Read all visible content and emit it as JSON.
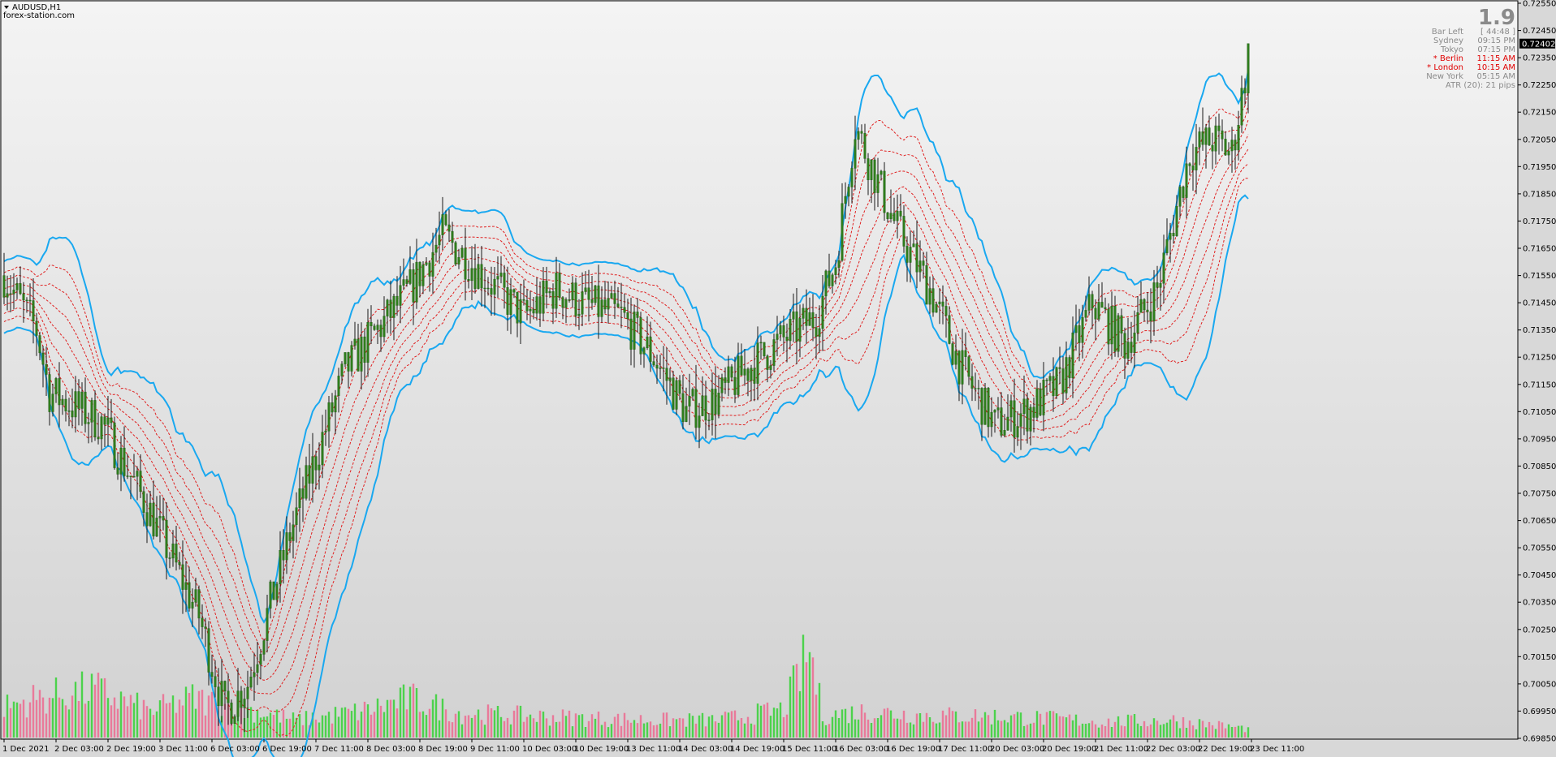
{
  "window": {
    "symbol_title": "AUDUSD,H1",
    "watermark": "forex-station.com"
  },
  "info_panel": {
    "spread": "1.9",
    "rows": [
      {
        "label": "Bar Left",
        "value": "[ 44:48 ]",
        "highlight": false
      },
      {
        "label": "Sydney",
        "value": "09:15 PM",
        "highlight": false
      },
      {
        "label": "Tokyo",
        "value": "07:15 PM",
        "highlight": false
      },
      {
        "label": "* Berlin",
        "value": "11:15 AM",
        "highlight": true
      },
      {
        "label": "* London",
        "value": "10:15 AM",
        "highlight": true
      },
      {
        "label": "New York",
        "value": "05:15 AM",
        "highlight": false
      },
      {
        "label": "ATR (20): 21 pips",
        "value": "",
        "highlight": false
      }
    ]
  },
  "colors": {
    "background_top": "#f4f4f4",
    "background_bottom": "#d2d2d2",
    "candle_bull": "#2e7d1c",
    "candle_bear": "#2e7d1c",
    "wick": "#1a1a1a",
    "band_outer": "#19a8f0",
    "band_inner": "#e02020",
    "volume_up": "#4cd24c",
    "volume_down": "#e97a9a",
    "price_tag_bg": "#000000",
    "price_tag_fg": "#ffffff"
  },
  "chart_data": {
    "type": "candlestick",
    "symbol": "AUDUSD",
    "timeframe": "H1",
    "ylim": [
      0.6985,
      0.7255
    ],
    "current_price": 0.72402,
    "current_price_label": "0.72402",
    "y_ticks": [
      "0.72550",
      "0.72450",
      "0.72350",
      "0.72250",
      "0.72150",
      "0.72050",
      "0.71950",
      "0.71850",
      "0.71750",
      "0.71650",
      "0.71550",
      "0.71450",
      "0.71350",
      "0.71250",
      "0.71150",
      "0.71050",
      "0.70950",
      "0.70850",
      "0.70750",
      "0.70650",
      "0.70550",
      "0.70450",
      "0.70350",
      "0.70250",
      "0.70150",
      "0.70050",
      "0.69950",
      "0.69850"
    ],
    "x_ticks": [
      "1 Dec 2021",
      "2 Dec 03:00",
      "2 Dec 19:00",
      "3 Dec 11:00",
      "6 Dec 03:00",
      "6 Dec 19:00",
      "7 Dec 11:00",
      "8 Dec 03:00",
      "8 Dec 19:00",
      "9 Dec 11:00",
      "10 Dec 03:00",
      "10 Dec 19:00",
      "13 Dec 11:00",
      "14 Dec 03:00",
      "14 Dec 19:00",
      "15 Dec 11:00",
      "16 Dec 03:00",
      "16 Dec 19:00",
      "17 Dec 11:00",
      "20 Dec 03:00",
      "20 Dec 19:00",
      "21 Dec 11:00",
      "22 Dec 03:00",
      "22 Dec 19:00",
      "23 Dec 11:00"
    ],
    "bars_per_x_tick": 16,
    "price_keypoints": [
      [
        0,
        0.7155
      ],
      [
        10,
        0.7135
      ],
      [
        14,
        0.7112
      ],
      [
        20,
        0.7108
      ],
      [
        30,
        0.7101
      ],
      [
        45,
        0.7068
      ],
      [
        60,
        0.703
      ],
      [
        68,
        0.6995
      ],
      [
        75,
        0.7005
      ],
      [
        88,
        0.706
      ],
      [
        105,
        0.712
      ],
      [
        125,
        0.715
      ],
      [
        135,
        0.717
      ],
      [
        150,
        0.7152
      ],
      [
        160,
        0.714
      ],
      [
        170,
        0.715
      ],
      [
        178,
        0.7145
      ],
      [
        190,
        0.714
      ],
      [
        200,
        0.7125
      ],
      [
        210,
        0.7105
      ],
      [
        220,
        0.711
      ],
      [
        228,
        0.712
      ],
      [
        238,
        0.713
      ],
      [
        250,
        0.714
      ],
      [
        256,
        0.716
      ],
      [
        262,
        0.721
      ],
      [
        268,
        0.7192
      ],
      [
        275,
        0.7172
      ],
      [
        285,
        0.715
      ],
      [
        295,
        0.712
      ],
      [
        305,
        0.71
      ],
      [
        315,
        0.7105
      ],
      [
        325,
        0.7115
      ],
      [
        335,
        0.7145
      ],
      [
        345,
        0.713
      ],
      [
        355,
        0.715
      ],
      [
        365,
        0.72
      ],
      [
        372,
        0.7205
      ],
      [
        378,
        0.72
      ],
      [
        383,
        0.7235
      ]
    ],
    "volume_keypoints": [
      [
        0,
        0.35
      ],
      [
        10,
        0.45
      ],
      [
        28,
        0.55
      ],
      [
        45,
        0.3
      ],
      [
        58,
        0.45
      ],
      [
        70,
        0.35
      ],
      [
        78,
        0.3
      ],
      [
        90,
        0.2
      ],
      [
        110,
        0.3
      ],
      [
        125,
        0.45
      ],
      [
        140,
        0.28
      ],
      [
        160,
        0.25
      ],
      [
        180,
        0.22
      ],
      [
        200,
        0.2
      ],
      [
        220,
        0.2
      ],
      [
        240,
        0.32
      ],
      [
        248,
        1.0
      ],
      [
        252,
        0.25
      ],
      [
        265,
        0.3
      ],
      [
        285,
        0.25
      ],
      [
        300,
        0.25
      ],
      [
        320,
        0.22
      ],
      [
        340,
        0.18
      ],
      [
        360,
        0.2
      ],
      [
        383,
        0.1
      ]
    ]
  }
}
